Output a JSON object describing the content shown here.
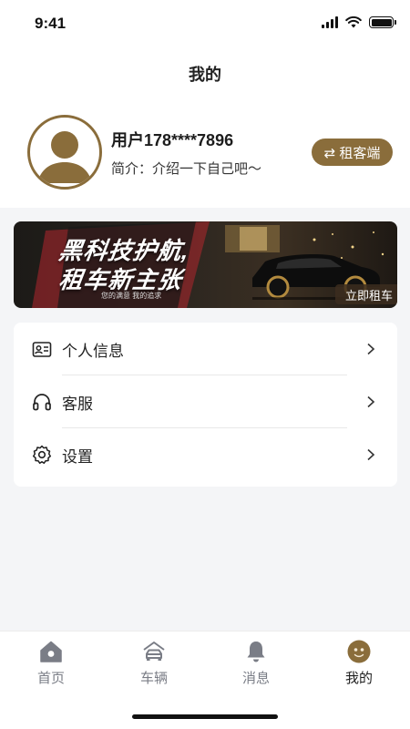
{
  "status_bar": {
    "time": "9:41"
  },
  "header": {
    "title": "我的"
  },
  "profile": {
    "username": "用户178****7896",
    "bio": "简介：介绍一下自己吧～",
    "switch_button": "⇄ 租客端"
  },
  "banner": {
    "headline_line1": "黑科技护航,",
    "headline_line2": "租车新主张",
    "slogan": "您的满意 我的追求",
    "cta": "立即租车"
  },
  "menu": {
    "items": [
      {
        "label": "个人信息",
        "icon": "id-card-icon"
      },
      {
        "label": "客服",
        "icon": "headset-icon"
      },
      {
        "label": "设置",
        "icon": "gear-icon"
      }
    ]
  },
  "tabbar": {
    "tabs": [
      {
        "label": "首页",
        "icon": "home-icon"
      },
      {
        "label": "车辆",
        "icon": "car-icon"
      },
      {
        "label": "消息",
        "icon": "bell-icon"
      },
      {
        "label": "我的",
        "icon": "profile-face-icon"
      }
    ],
    "active_index": 3
  },
  "colors": {
    "accent": "#8a6d3b",
    "tab_inactive": "#7a7d86",
    "background": "#f4f5f7"
  }
}
